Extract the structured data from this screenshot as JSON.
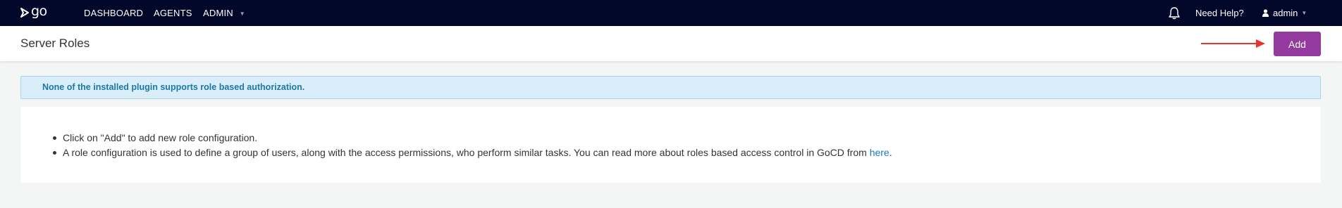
{
  "topnav": {
    "logo_text": "go",
    "items": [
      {
        "label": "DASHBOARD"
      },
      {
        "label": "AGENTS"
      },
      {
        "label": "ADMIN"
      }
    ],
    "help_label": "Need Help?",
    "user_label": "admin"
  },
  "header": {
    "title": "Server Roles",
    "add_label": "Add"
  },
  "info": {
    "message": "None of the installed plugin supports role based authorization."
  },
  "content": {
    "bullet1": "Click on \"Add\" to add new role configuration.",
    "bullet2_prefix": "A role configuration is used to define a group of users, along with the access permissions, who perform similar tasks. You can read more about roles based access control in GoCD from ",
    "bullet2_link": "here",
    "bullet2_suffix": "."
  },
  "colors": {
    "nav_bg": "#000728",
    "accent_button": "#943a9e",
    "info_bg": "#d9eef8",
    "info_text": "#1b78a7",
    "annotation_arrow": "#e8352a"
  },
  "icons": [
    "go-logo-icon",
    "caret-down-icon",
    "bell-icon",
    "user-icon"
  ]
}
